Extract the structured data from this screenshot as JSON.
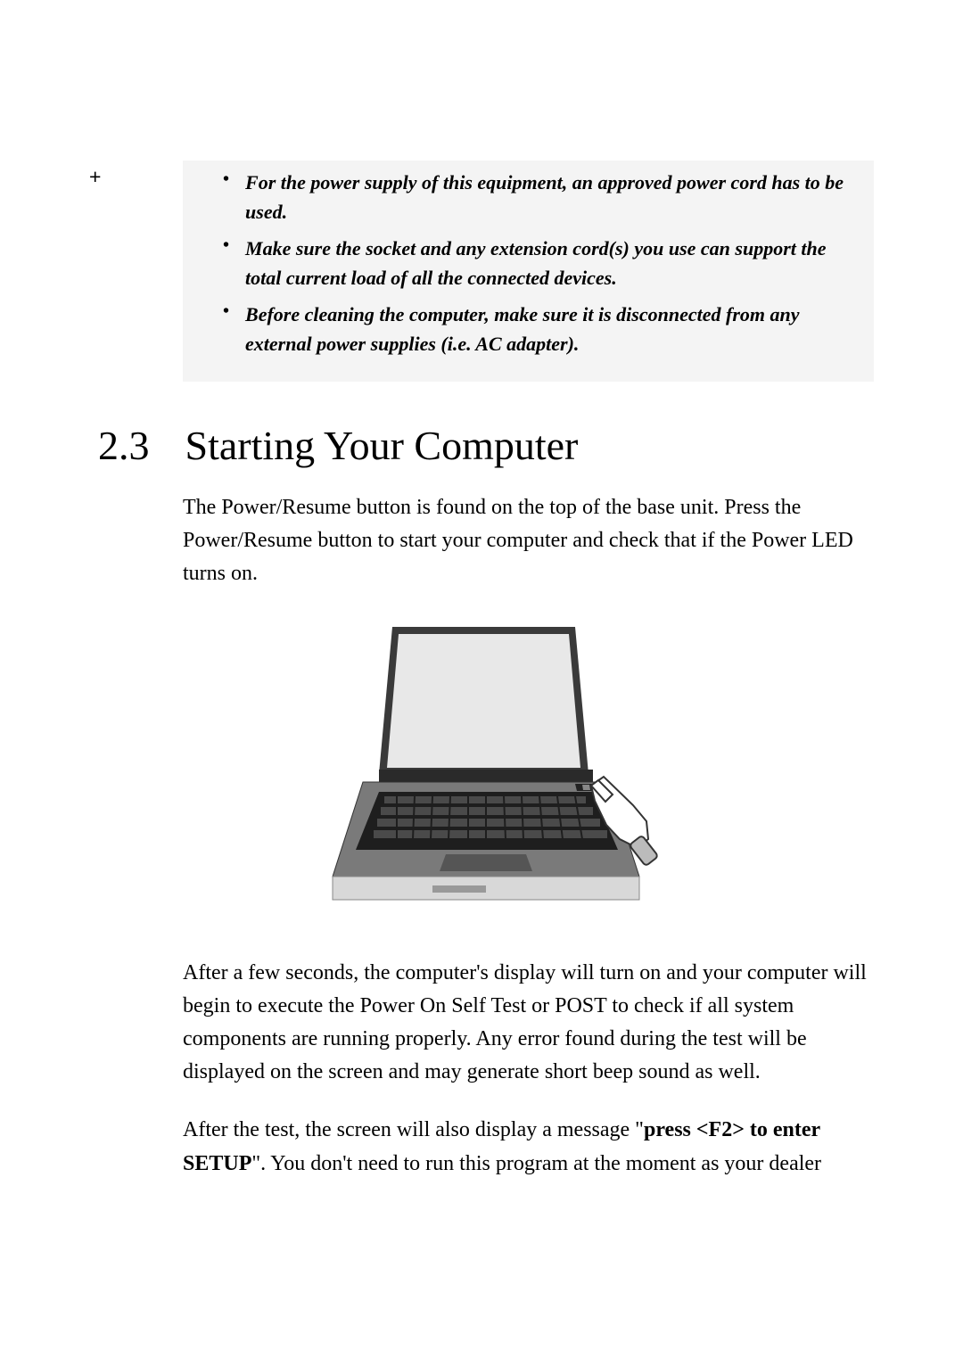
{
  "noteBox": {
    "plus": "+",
    "bullets": [
      "For the power supply of this equipment, an approved power cord has to be used.",
      "Make sure the socket and any extension cord(s) you use can support the total current load of all the connected devices.",
      "Before cleaning the computer, make sure it is disconnected from any external power supplies (i.e. AC adapter)."
    ]
  },
  "section": {
    "number": "2.3",
    "title": "Starting Your Computer"
  },
  "paragraphs": {
    "intro": "The Power/Resume button is found on the top of the base unit. Press the Power/Resume button to start your computer and check that if the Power LED turns on.",
    "afterFew": "After a few seconds, the computer's display will turn on and your computer will begin to execute the Power On Self Test or POST to check if all system components are running properly. Any error found during the test will be displayed on the screen and may generate short beep sound as well.",
    "afterTest_pre": "After the test, the screen will also display a message \"",
    "afterTest_bold": "press <F2> to enter SETUP",
    "afterTest_post": "\". You don't need to run this program at the moment as your dealer"
  },
  "illustration": {
    "alt": "laptop-with-hand-pressing-power"
  }
}
